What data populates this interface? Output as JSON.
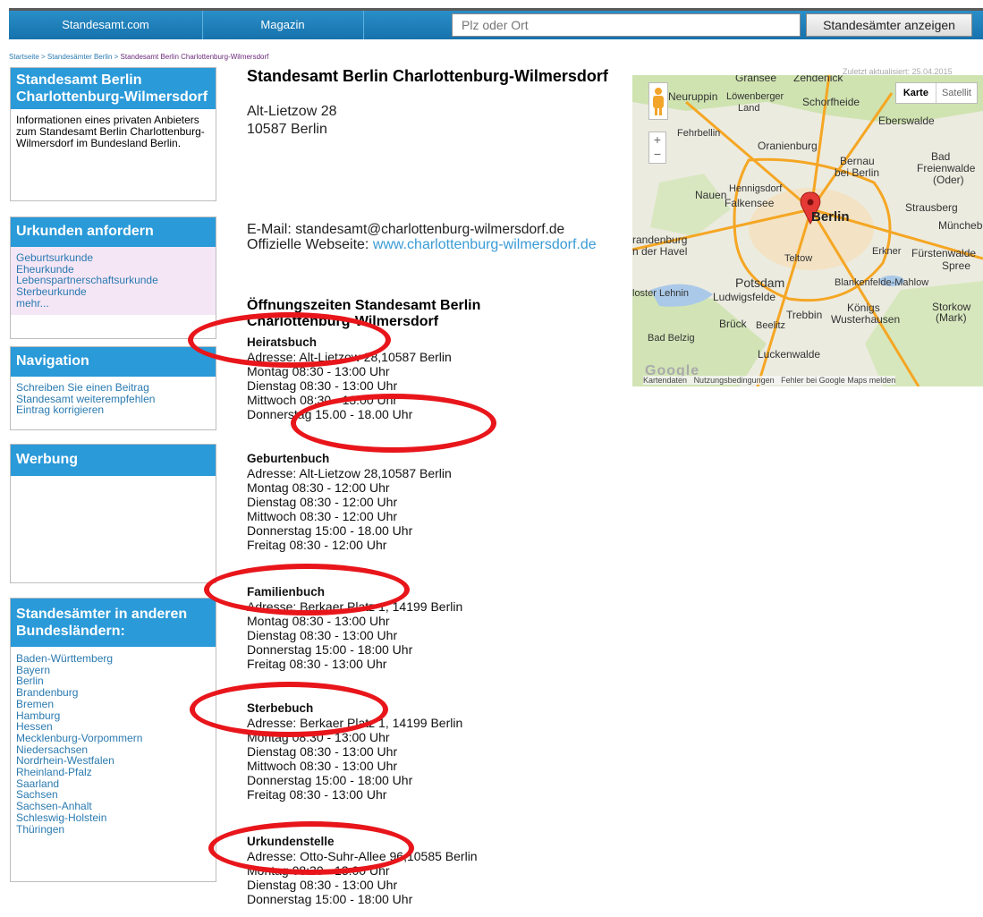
{
  "nav": {
    "tab1": "Standesamt.com",
    "tab2": "Magazin",
    "search_placeholder": "Plz oder Ort",
    "search_button": "Standesämter anzeigen"
  },
  "breadcrumb": [
    "Startseite",
    "Standesämter Berlin",
    "Standesamt Berlin Charlottenburg-Wilmersdorf"
  ],
  "sidebar": {
    "info": {
      "title": "Standesamt Berlin Charlottenburg-Wilmersdorf",
      "text": "Informationen eines privaten Anbieters zum Standesamt Berlin Charlottenburg-Wilmersdorf im Bundesland Berlin."
    },
    "urkunden": {
      "title": "Urkunden anfordern",
      "items": [
        "Geburtsurkunde",
        "Eheurkunde",
        "Lebenspartnerschaftsurkunde",
        "Sterbeurkunde",
        "mehr..."
      ]
    },
    "navigation": {
      "title": "Navigation",
      "items": [
        "Schreiben Sie einen Beitrag",
        "Standesamt weiterempfehlen",
        "Eintrag korrigieren"
      ]
    },
    "werbung": {
      "title": "Werbung"
    },
    "laender": {
      "title": "Standesämter in anderen Bundesländern:",
      "items": [
        "Baden-Württemberg",
        "Bayern",
        "Berlin",
        "Brandenburg",
        "Bremen",
        "Hamburg",
        "Hessen",
        "Mecklenburg-Vorpommern",
        "Niedersachsen",
        "Nordrhein-Westfalen",
        "Rheinland-Pfalz",
        "Saarland",
        "Sachsen",
        "Sachsen-Anhalt",
        "Schleswig-Holstein",
        "Thüringen"
      ]
    }
  },
  "main": {
    "title": "Standesamt Berlin Charlottenburg-Wilmersdorf",
    "address_line1": "Alt-Lietzow 28",
    "address_line2": "10587 Berlin",
    "email_label": "E-Mail:",
    "email": "standesamt@charlottenburg-wilmersdorf.de",
    "website_label": "Offizielle Webseite:",
    "website": "www.charlottenburg-wilmersdorf.de",
    "hours_title": "Öffnungszeiten Standesamt Berlin Charlottenburg-Wilmersdorf",
    "sections": [
      {
        "name": "Heiratsbuch",
        "lines": [
          "Adresse: Alt-Lietzow 28,10587 Berlin",
          "Montag 08:30 - 13:00 Uhr",
          "Dienstag 08:30 - 13:00 Uhr",
          "Mittwoch 08:30 - 13:00 Uhr",
          "Donnerstag 15.00 - 18.00 Uhr"
        ]
      },
      {
        "name": "Geburtenbuch",
        "lines": [
          "Adresse: Alt-Lietzow 28,10587 Berlin",
          "Montag 08:30 - 12:00 Uhr",
          "Dienstag 08:30 - 12:00 Uhr",
          "Mittwoch 08:30 - 12:00 Uhr",
          "Donnerstag 15:00 - 18.00 Uhr",
          "Freitag 08:30 - 12:00 Uhr"
        ]
      },
      {
        "name": "Familienbuch",
        "lines": [
          "Adresse: Berkaer Platz 1, 14199 Berlin",
          "Montag 08:30 - 13:00 Uhr",
          "Dienstag 08:30 - 13:00 Uhr",
          "Donnerstag 15:00 - 18:00 Uhr",
          "Freitag 08:30 - 13:00 Uhr"
        ]
      },
      {
        "name": "Sterbebuch",
        "lines": [
          "Adresse: Berkaer Platz 1, 14199 Berlin",
          "Montag 08:30 - 13:00 Uhr",
          "Dienstag 08:30 - 13:00 Uhr",
          "Mittwoch 08:30 - 13:00 Uhr",
          "Donnerstag 15:00 - 18:00 Uhr",
          "Freitag 08:30 - 13:00 Uhr"
        ]
      },
      {
        "name": "Urkundenstelle",
        "lines": [
          "Adresse: Otto-Suhr-Allee 96,10585 Berlin",
          "Montag 08:30 - 13:00 Uhr",
          "Dienstag 08:30 - 13:00 Uhr",
          "Donnerstag 15:00 - 18:00 Uhr"
        ]
      }
    ]
  },
  "map": {
    "updated": "Zuletzt aktualisiert: 25.04.2015",
    "type_map": "Karte",
    "type_satellite": "Satellit",
    "zoom_in": "+",
    "zoom_out": "−",
    "logo": "Google",
    "footer": [
      "Kartendaten",
      "Nutzungsbedingungen",
      "Fehler bei Google Maps melden"
    ],
    "places": [
      "Gransee",
      "Zehdenick",
      "Neuruppin",
      "Löwenberger Land",
      "Schorfheide",
      "Eberswalde",
      "Fehrbellin",
      "Oranienburg",
      "Bernau bei Berlin",
      "Bad Freienwalde (Oder)",
      "Nauen",
      "Hennigsdorf",
      "Falkensee",
      "Berlin",
      "Strausberg",
      "Müncheberg",
      "Brandenburg an der Havel",
      "Teltow",
      "Erkner",
      "Fürstenwalde/Spree",
      "Potsdam",
      "Blankenfelde-Mahlow",
      "Kloster Lehnin",
      "Ludwigsfelde",
      "Trebbin",
      "Königs Wusterhausen",
      "Storkow (Mark)",
      "Brück",
      "Beelitz",
      "Bad Belzig",
      "Luckenwalde"
    ],
    "marker_color": "#e53935",
    "road_color": "#f5a623"
  },
  "annotation_color": "#e8161b"
}
